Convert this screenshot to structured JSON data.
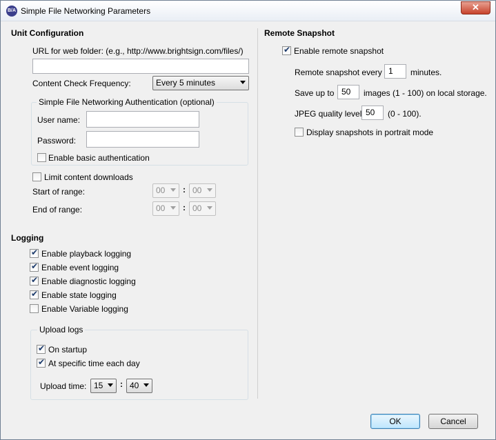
{
  "window": {
    "title": "Simple File Networking Parameters",
    "icon_label": "B/A",
    "close_glyph": "✕"
  },
  "unit_config": {
    "header": "Unit Configuration",
    "url_label": "URL for web folder: (e.g., http://www.brightsign.com/files/)",
    "url_value": "",
    "freq_label": "Content Check Frequency:",
    "freq_value": "Every 5 minutes",
    "auth": {
      "title": "Simple File Networking Authentication (optional)",
      "user_label": "User name:",
      "user_value": "",
      "password_label": "Password:",
      "password_value": "",
      "basic_auth_label": "Enable basic authentication",
      "basic_auth_checked": false
    },
    "limit_label": "Limit content downloads",
    "limit_checked": false,
    "start_label": "Start of range:",
    "start_hour": "00",
    "start_minute": "00",
    "end_label": "End of range:",
    "end_hour": "00",
    "end_minute": "00",
    "colon": ":"
  },
  "logging": {
    "header": "Logging",
    "options": [
      {
        "label": "Enable playback logging",
        "checked": true
      },
      {
        "label": "Enable event logging",
        "checked": true
      },
      {
        "label": "Enable diagnostic logging",
        "checked": true
      },
      {
        "label": "Enable state logging",
        "checked": true
      },
      {
        "label": "Enable Variable logging",
        "checked": false
      }
    ],
    "upload": {
      "title": "Upload logs",
      "on_startup_label": "On startup",
      "on_startup_checked": true,
      "specific_time_label": "At specific time each day",
      "specific_time_checked": true,
      "time_label": "Upload time:",
      "hour": "15",
      "minute": "40",
      "colon": ":"
    }
  },
  "remote_snapshot": {
    "header": "Remote Snapshot",
    "enable_label": "Enable remote snapshot",
    "enable_checked": true,
    "every_label": "Remote snapshot every",
    "every_value": "1",
    "every_unit": "minutes.",
    "save_label": "Save up to",
    "save_value": "50",
    "save_unit": "images (1 - 100) on local storage.",
    "quality_label": "JPEG quality level",
    "quality_value": "50",
    "quality_unit": "(0 - 100).",
    "portrait_label": "Display snapshots in portrait mode",
    "portrait_checked": false
  },
  "buttons": {
    "ok": "OK",
    "cancel": "Cancel"
  }
}
